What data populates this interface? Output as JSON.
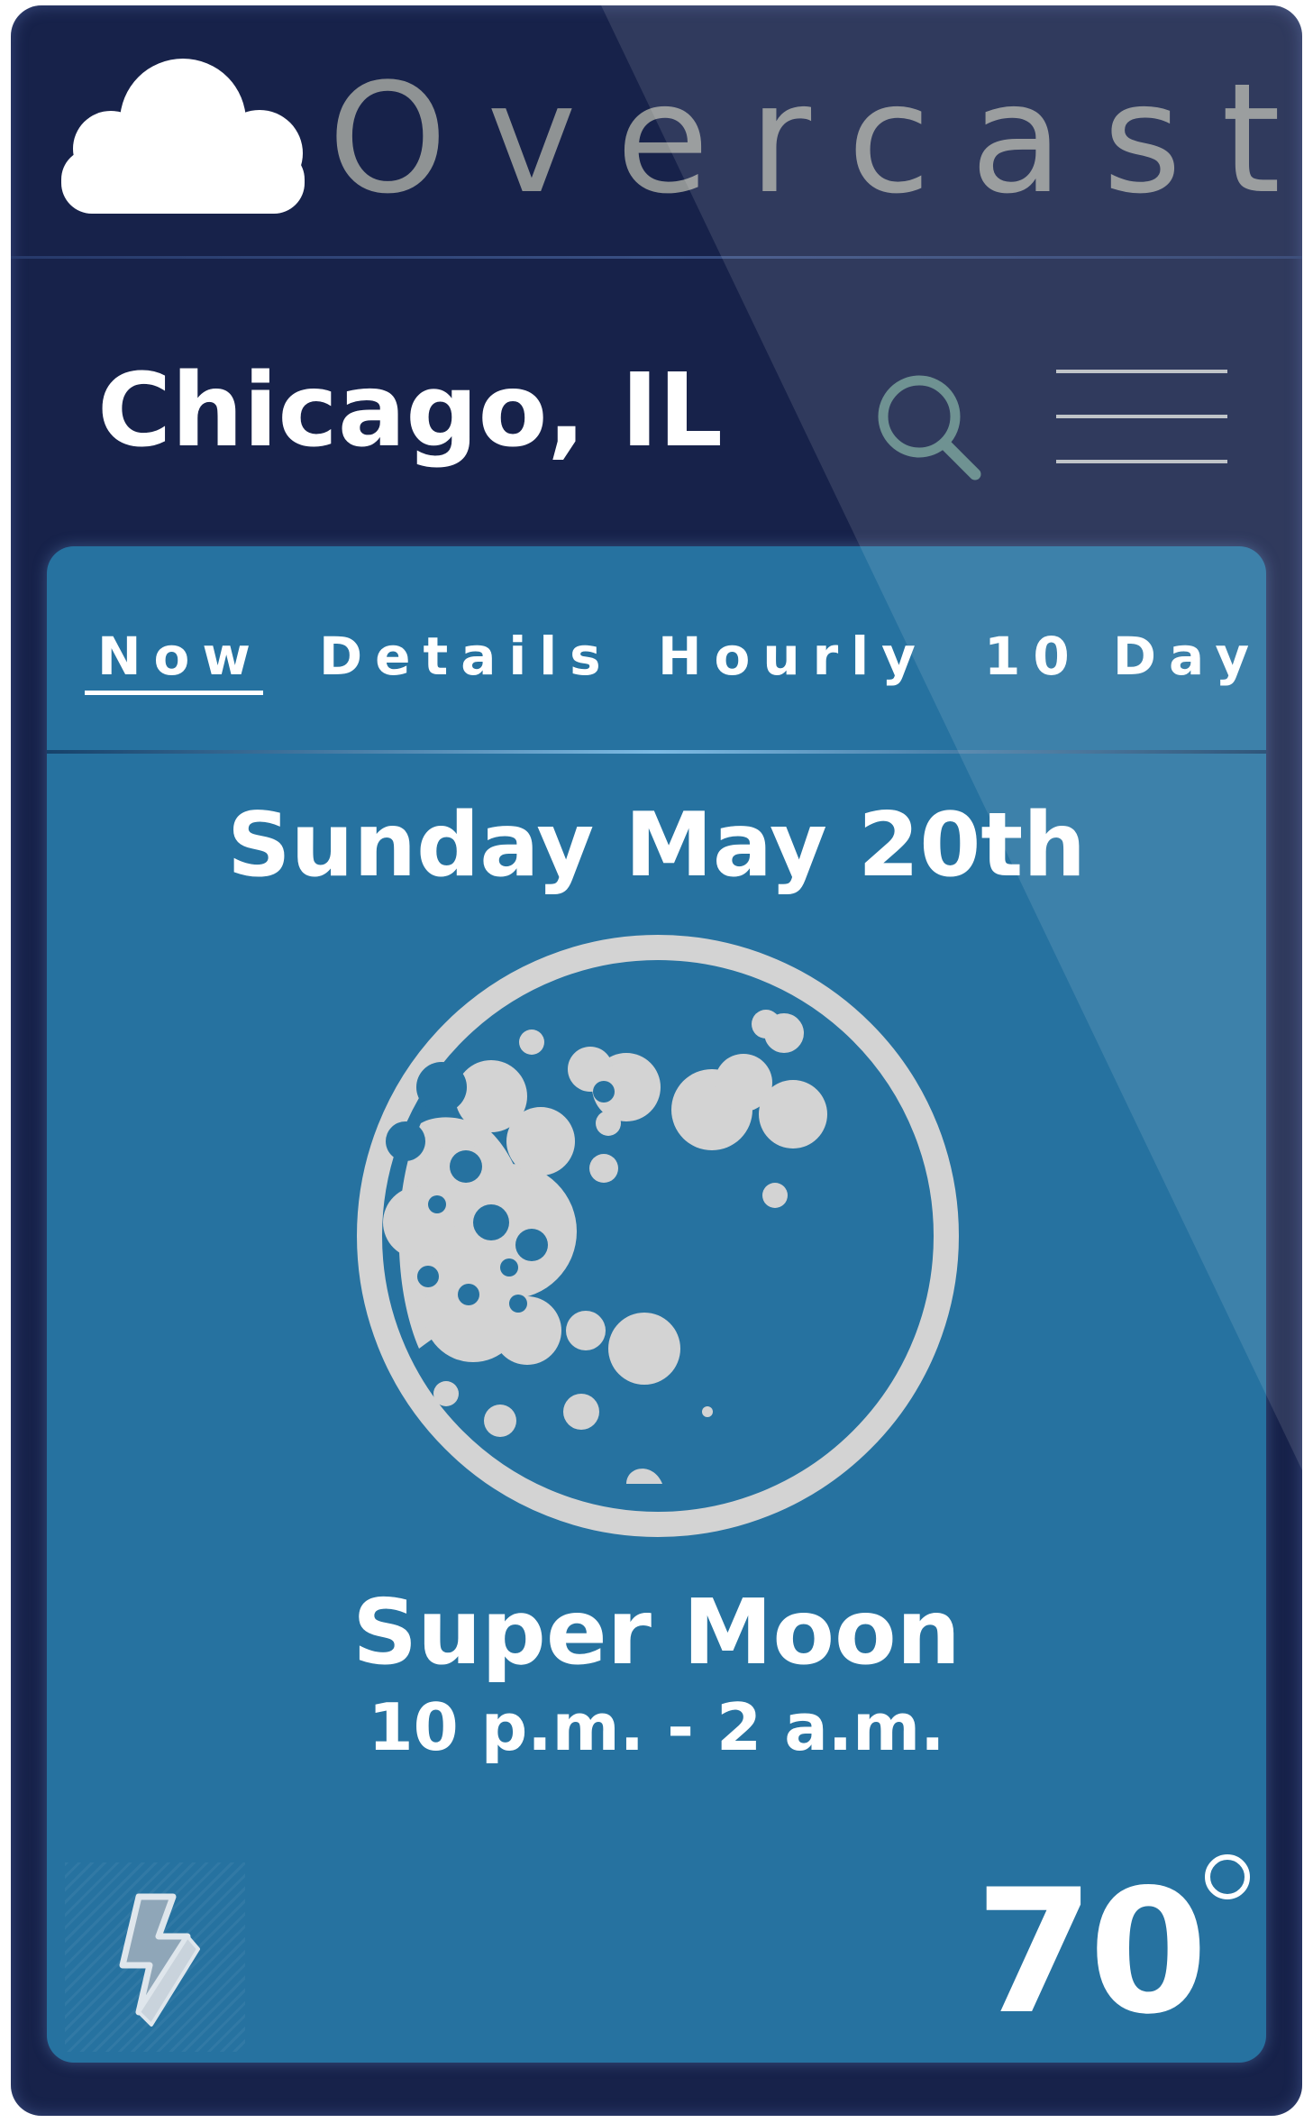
{
  "app": {
    "brand": "Overcast",
    "brand_icon": "cloud-icon"
  },
  "location": {
    "city": "Chicago, IL"
  },
  "toolbar": {
    "search_icon": "search-icon",
    "menu_icon": "hamburger-menu-icon"
  },
  "tabs": [
    {
      "label": "Now",
      "active": true
    },
    {
      "label": "Details",
      "active": false
    },
    {
      "label": "Hourly",
      "active": false
    },
    {
      "label": "10 Day",
      "active": false
    }
  ],
  "forecast": {
    "date": "Sunday May 20th",
    "event_icon": "moon-icon",
    "event_title": "Super Moon",
    "event_time": "10 p.m. - 2 a.m.",
    "alert_icon": "lightning-bolt-icon",
    "temperature": "70",
    "degree_symbol": "°"
  },
  "colors": {
    "background": "#17224a",
    "card": "#2672a0",
    "brand_text": "#8f9394",
    "moon": "#d3d3d3",
    "search_icon": "#5e8585"
  }
}
